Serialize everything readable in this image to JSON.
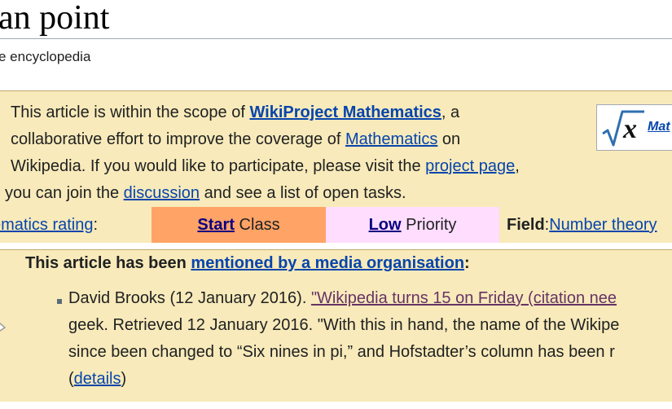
{
  "page": {
    "title": "an point",
    "tagline": "e encyclopedia"
  },
  "wikiproject": {
    "line1_pre": "This article is within the scope of ",
    "project_link": "WikiProject Mathematics",
    "line1_post": ", a",
    "line2_pre": "collaborative effort to improve the coverage of ",
    "topic_link": "Mathematics",
    "line2_post": " on",
    "line3_pre": "Wikipedia. If you would like to participate, please visit the ",
    "project_page_link": "project page",
    "line3_post": ",",
    "line4_pre": "you can join the ",
    "discussion_link": "discussion",
    "line4_post": " and see a list of open tasks.",
    "logo_link": "Mat",
    "logo_icon": "sqrt-x-icon"
  },
  "rating": {
    "label_link": "ematics rating",
    "label_suffix": ":",
    "class_link": "Start",
    "class_suffix": " Class",
    "class_color": "#ffa366",
    "priority_link": "Low",
    "priority_suffix": " Priority",
    "priority_color": "#ffddff",
    "field_label": "Field",
    "field_sep": ":",
    "field_link": "Number theory"
  },
  "media": {
    "heading_pre": "This article has been ",
    "heading_link": "mentioned by a media organisation",
    "heading_post": ":",
    "entry_line1_pre": "David Brooks (12 January 2016). ",
    "entry_cite_link": "\"Wikipedia turns 15 on Friday (citation nee",
    "entry_line2": "geek. Retrieved 12 January 2016. \"With this in hand, the name of the Wikipe",
    "entry_line3": "since been changed to “Six nines in pi,” and Hofstadter’s column has been r",
    "entry_line4_pre": "(",
    "details_link": "details",
    "entry_line4_post": ")"
  }
}
